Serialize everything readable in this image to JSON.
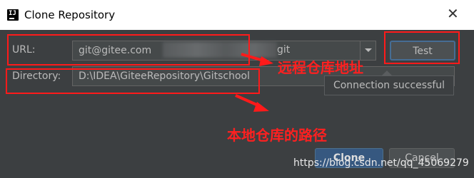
{
  "window": {
    "title": "Clone Repository",
    "icon": "intellij-idea-icon",
    "close_icon": "close-icon"
  },
  "form": {
    "url_label": "URL:",
    "url_value": "git@gitee.com",
    "url_tail": "git",
    "directory_label": "Directory:",
    "directory_value": "D:\\IDEA\\GiteeRepository\\Gitschool"
  },
  "buttons": {
    "test": "Test",
    "clone": "Clone",
    "cancel": "Cancel"
  },
  "tooltip": {
    "text": "Connection successful"
  },
  "annotations": {
    "remote": "远程仓库地址",
    "local": "本地仓库的路径"
  },
  "watermark": "https://blog.csdn.net/qq_45069279",
  "colors": {
    "dialog_bg": "#3c3f41",
    "annotation_red": "#ff1a1a",
    "clone_blue": "#365880"
  }
}
